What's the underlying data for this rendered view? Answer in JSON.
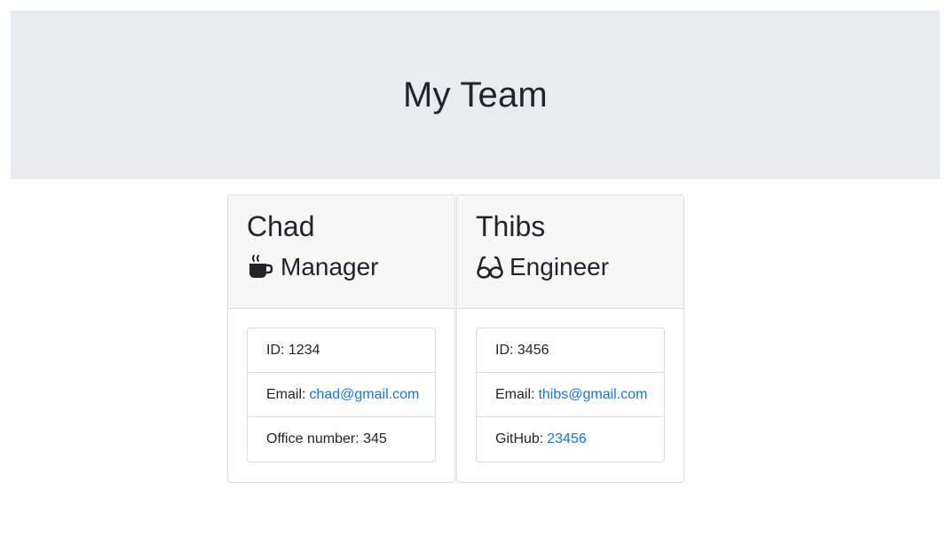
{
  "header": {
    "title": "My Team"
  },
  "team": [
    {
      "name": "Chad",
      "role": "Manager",
      "role_icon": "coffee-mug-icon",
      "id_label": "ID: 1234",
      "email_label": "Email:",
      "email": "chad@gmail.com",
      "extra_label": "Office number: 345"
    },
    {
      "name": "Thibs",
      "role": "Engineer",
      "role_icon": "glasses-icon",
      "id_label": "ID: 3456",
      "email_label": "Email:",
      "email": "thibs@gmail.com",
      "extra_label": "GitHub:",
      "extra_link": "23456"
    }
  ],
  "colors": {
    "header_bg": "#e9ecef",
    "card_header_bg": "#f7f7f7",
    "link": "#1a73e8",
    "text": "#212529"
  }
}
